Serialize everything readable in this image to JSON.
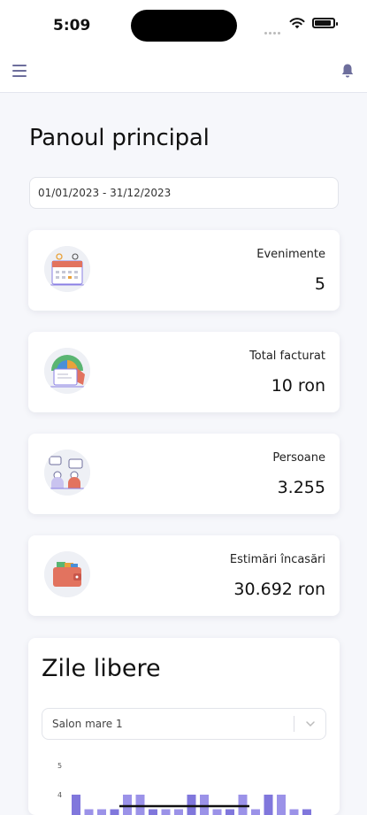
{
  "status": {
    "time": "5:09"
  },
  "header": {
    "menu_icon": "hamburger-icon",
    "bell_icon": "bell-icon"
  },
  "dashboard": {
    "title": "Panoul principal",
    "date_range": "01/01/2023 - 31/12/2023",
    "stats": [
      {
        "label": "Evenimente",
        "value": "5",
        "icon": "calendar-icon"
      },
      {
        "label": "Total facturat",
        "value": "10 ron",
        "icon": "invoice-icon"
      },
      {
        "label": "Persoane",
        "value": "3.255",
        "icon": "people-icon"
      },
      {
        "label": "Estimări încasări",
        "value": "30.692 ron",
        "icon": "wallet-icon"
      }
    ]
  },
  "holidays": {
    "title": "Zile libere",
    "select_value": "Salon mare 1"
  },
  "chart_data": {
    "type": "bar",
    "ytick_labels": [
      "5",
      "4"
    ],
    "ylim": [
      3,
      5
    ],
    "values": [
      4,
      3.5,
      3.5,
      3.5,
      4,
      4,
      3.5,
      3.5,
      3.5,
      4,
      4,
      3.5,
      3.5,
      4,
      3.5,
      4,
      4,
      3.5,
      3.5
    ],
    "colors": {
      "bar": "#8a7fe4",
      "bar_dark": "#6a5fd6"
    }
  },
  "colors": {
    "accent": "#6d6e9c",
    "card_bg": "#ffffff",
    "page_bg": "#f6f7fb"
  }
}
